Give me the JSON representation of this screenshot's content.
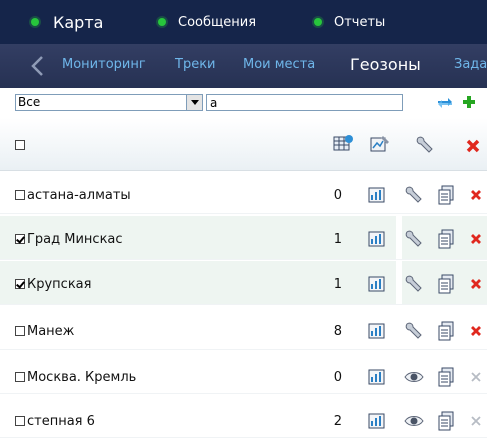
{
  "top_tabs": [
    {
      "label": "Карта"
    },
    {
      "label": "Сообщения"
    },
    {
      "label": "Отчеты"
    }
  ],
  "subnav": {
    "items": [
      {
        "label": "Мониторинг"
      },
      {
        "label": "Треки"
      },
      {
        "label": "Мои места"
      },
      {
        "label": "Геозоны"
      },
      {
        "label": "Зада"
      }
    ],
    "active": "Геозоны"
  },
  "filter": {
    "select_value": "Все",
    "search_value": "а"
  },
  "table": {
    "rows": [
      {
        "name": "астана-алматы",
        "count": "0",
        "checked": false,
        "third_icon": "wrench-icon",
        "delete_active": true
      },
      {
        "name": "Град Минскас",
        "count": "1",
        "checked": true,
        "third_icon": "wrench-icon",
        "delete_active": true
      },
      {
        "name": "Крупская",
        "count": "1",
        "checked": true,
        "third_icon": "wrench-icon",
        "delete_active": true
      },
      {
        "name": "Манеж",
        "count": "8",
        "checked": false,
        "third_icon": "wrench-icon",
        "delete_active": true
      },
      {
        "name": "Москва. Кремль",
        "count": "0",
        "checked": false,
        "third_icon": "eye-icon",
        "delete_active": false
      },
      {
        "name": "степная 6",
        "count": "2",
        "checked": false,
        "third_icon": "eye-icon",
        "delete_active": false
      }
    ]
  },
  "colors": {
    "topbar": "#15254a",
    "subnav": "#2d3759",
    "link": "#6fb6ea",
    "dot": "#27c63c",
    "delete": "#e0281e",
    "row_alt": "#eef5f1"
  }
}
